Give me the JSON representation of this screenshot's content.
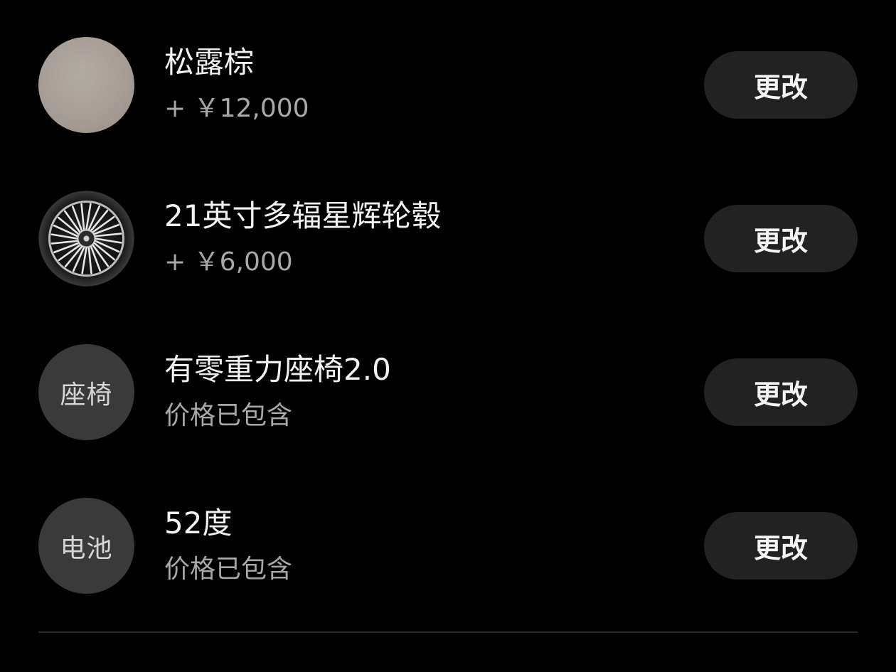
{
  "options": [
    {
      "thumb_type": "swatch",
      "thumb_icon": "color-swatch-icon",
      "thumb_color": "#a69e94",
      "title": "松露棕",
      "subtitle": "+ ￥12,000",
      "button_label": "更改"
    },
    {
      "thumb_type": "wheel",
      "thumb_icon": "wheel-icon",
      "title": "21英寸多辐星辉轮毂",
      "subtitle": "+ ￥6,000",
      "button_label": "更改"
    },
    {
      "thumb_type": "text",
      "thumb_label": "座椅",
      "title": "有零重力座椅2.0",
      "subtitle": "价格已包含",
      "button_label": "更改"
    },
    {
      "thumb_type": "text",
      "thumb_label": "电池",
      "title": "52度",
      "subtitle": "价格已包含",
      "button_label": "更改"
    }
  ],
  "colors": {
    "background": "#000000",
    "button_bg": "#222222",
    "title_text": "#f2f2f2",
    "subtitle_text": "#a8a8a8",
    "placeholder_circle": "#3a3a3a"
  }
}
